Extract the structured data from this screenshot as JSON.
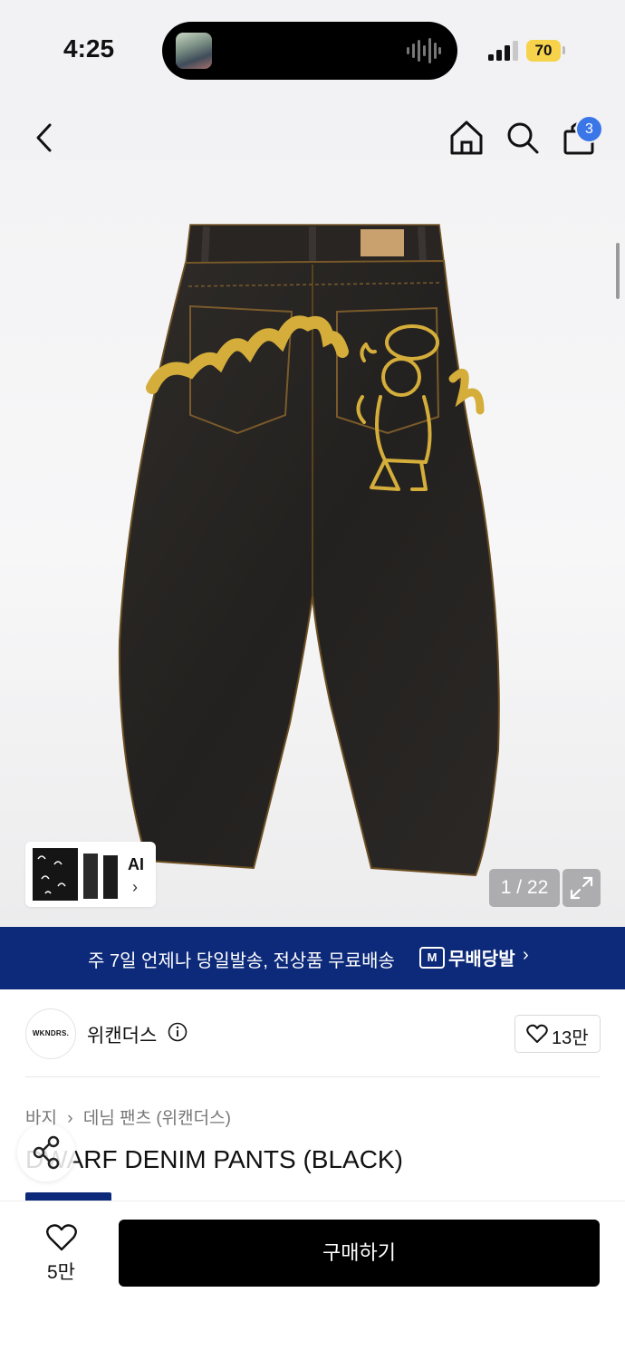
{
  "status_bar": {
    "time": "4:25",
    "battery": "70"
  },
  "nav": {
    "cart_count": "3"
  },
  "gallery": {
    "ai_label": "AI",
    "ai_arrow": "›",
    "page_counter": "1 / 22"
  },
  "shipping_banner": {
    "text": "주 7일 언제나 당일발송, 전상품 무료배송",
    "badge_icon_letter": "M",
    "badge_label": "무배당발",
    "chevron": "›"
  },
  "brand": {
    "logo_text": "WKNDRS.",
    "name": "위캔더스",
    "like_count": "13만"
  },
  "breadcrumb": {
    "category": "바지",
    "separator": "›",
    "subcategory": "데님 팬츠 (위캔더스)"
  },
  "product": {
    "title": "DWARF DENIM PANTS (BLACK)"
  },
  "bottom_bar": {
    "wish_count": "5만",
    "buy_label": "구매하기"
  },
  "colors": {
    "banner_bg": "#0d2a7a",
    "badge_blue": "#3b76e8",
    "buy_bg": "#000000",
    "battery": "#f6d34a",
    "print_yellow": "#d4ad3a"
  }
}
